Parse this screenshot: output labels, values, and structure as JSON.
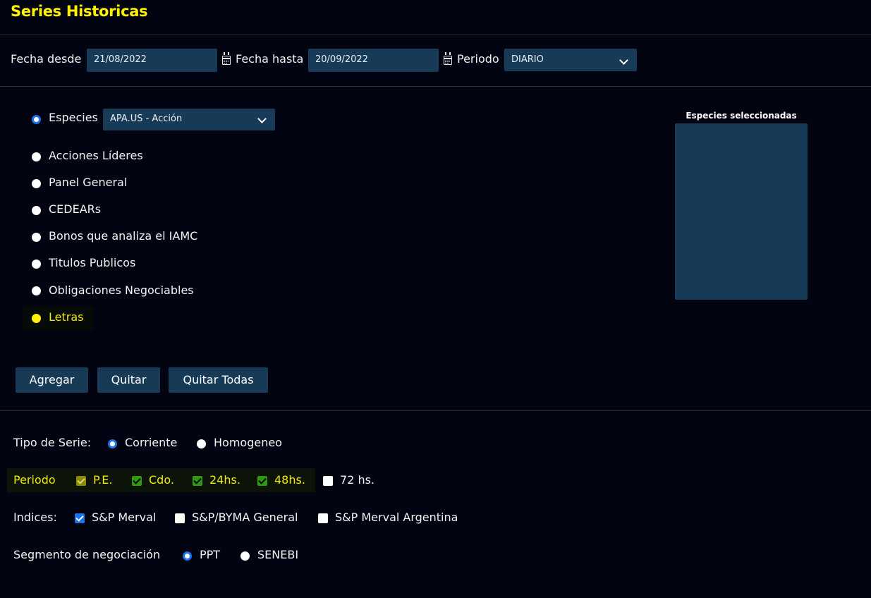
{
  "page_title": "Series Historicas",
  "filters": {
    "fecha_desde_label": "Fecha desde",
    "fecha_desde_value": "21/08/2022",
    "fecha_hasta_label": "Fecha hasta",
    "fecha_hasta_value": "20/09/2022",
    "periodo_label": "Periodo",
    "periodo_value": "DIARIO"
  },
  "species": {
    "options": [
      {
        "label": "Especies",
        "selected": true
      },
      {
        "label": "Acciones Líderes",
        "selected": false
      },
      {
        "label": "Panel General",
        "selected": false
      },
      {
        "label": "CEDEARs",
        "selected": false
      },
      {
        "label": "Bonos que analiza el IAMC",
        "selected": false
      },
      {
        "label": "Titulos Publicos",
        "selected": false
      },
      {
        "label": "Obligaciones Negociables",
        "selected": false
      },
      {
        "label": "Letras",
        "selected": false,
        "highlighted": true
      }
    ],
    "especie_select_value": "APA.US - Acción",
    "selected_box_title": "Especies seleccionadas"
  },
  "buttons": {
    "agregar": "Agregar",
    "quitar": "Quitar",
    "quitar_todas": "Quitar Todas"
  },
  "tipo_serie": {
    "label": "Tipo de Serie:",
    "options": [
      {
        "label": "Corriente",
        "selected": true
      },
      {
        "label": "Homogeneo",
        "selected": false
      }
    ]
  },
  "periodo_plazo": {
    "label": "Periodo",
    "options": [
      {
        "label": "P.E.",
        "checked": true
      },
      {
        "label": "Cdo.",
        "checked": true
      },
      {
        "label": "24hs.",
        "checked": true
      },
      {
        "label": "48hs.",
        "checked": true
      },
      {
        "label": "72 hs.",
        "checked": false
      }
    ]
  },
  "indices": {
    "label": "Indices:",
    "options": [
      {
        "label": "S&P Merval",
        "checked": true
      },
      {
        "label": "S&P/BYMA General",
        "checked": false
      },
      {
        "label": "S&P Merval Argentina",
        "checked": false
      }
    ]
  },
  "segmento": {
    "label": "Segmento de negociación",
    "options": [
      {
        "label": "PPT",
        "selected": true
      },
      {
        "label": "SENEBI",
        "selected": false
      }
    ]
  },
  "colors": {
    "background": "#020412",
    "title_yellow": "#fff200",
    "field_bg": "#173a56",
    "radio_blue": "#1a73e8",
    "check_green": "#2e9a11"
  }
}
